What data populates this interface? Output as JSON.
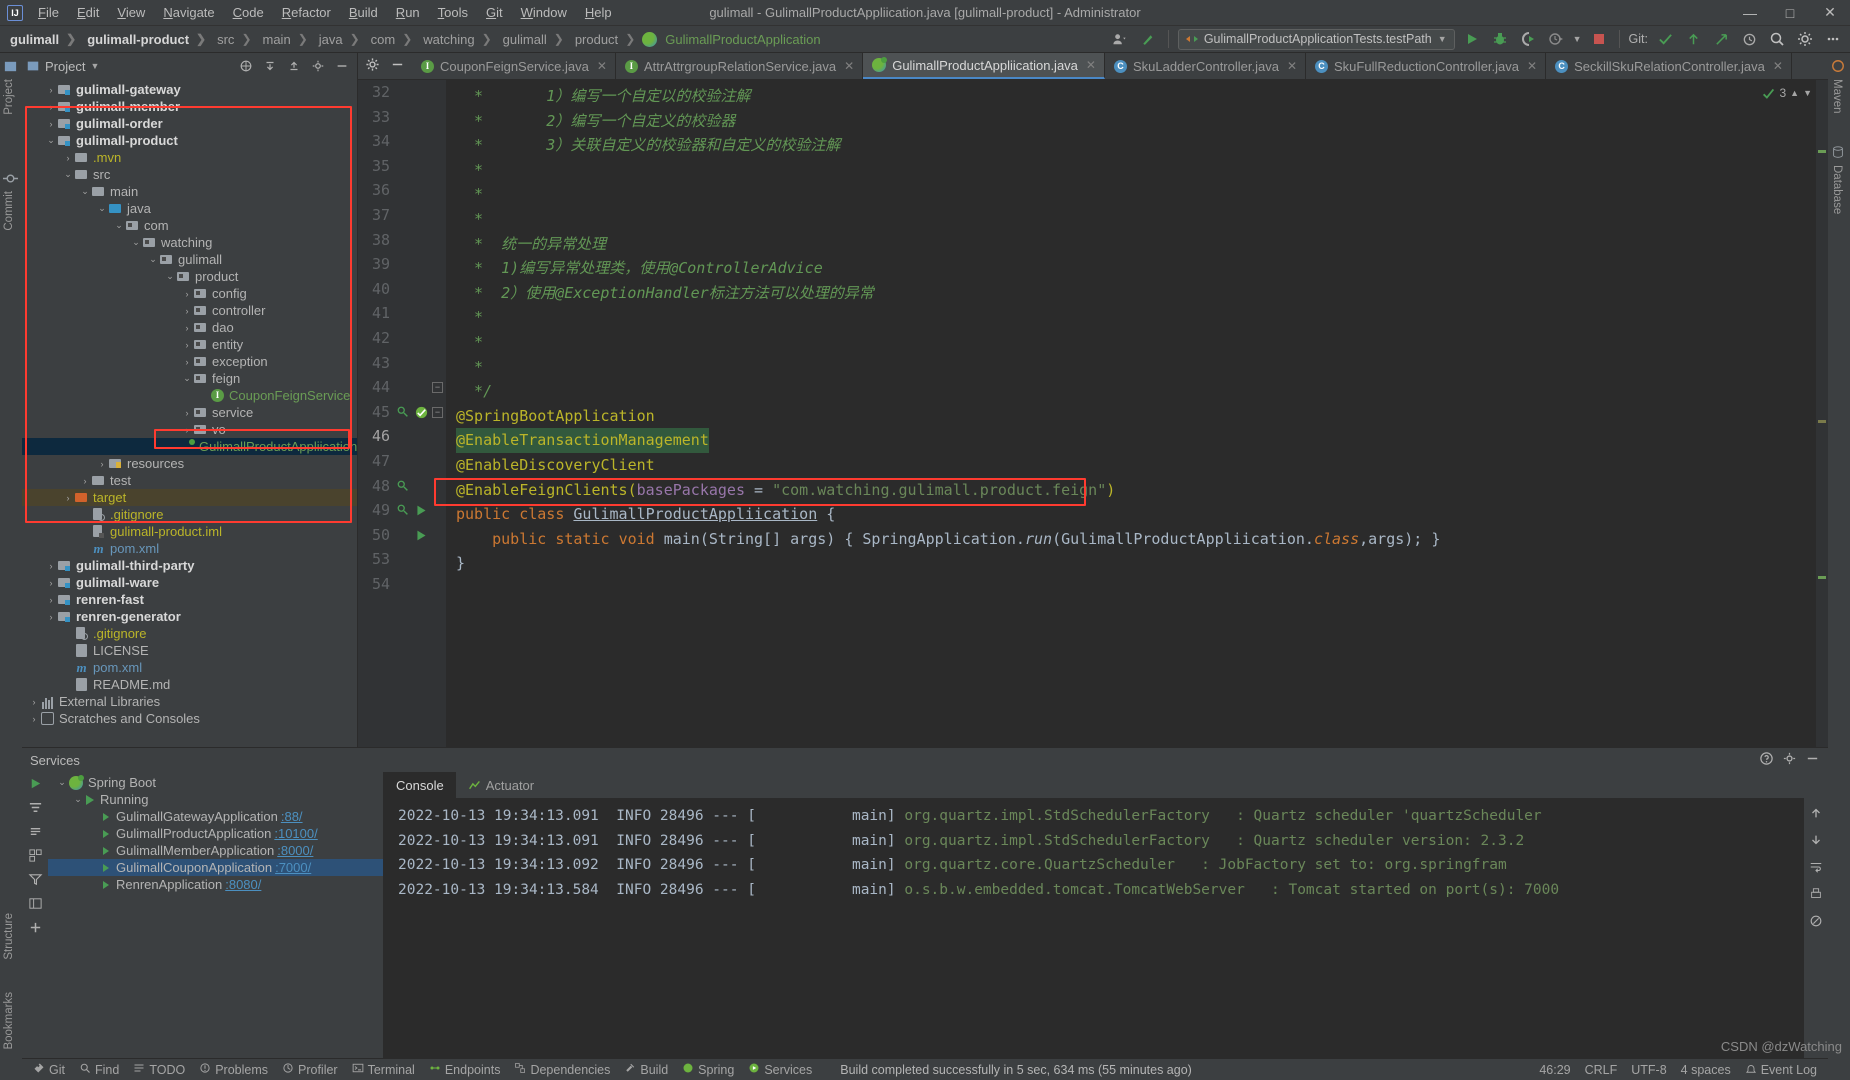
{
  "window": {
    "title": "gulimall - GulimallProductAppliication.java [gulimall-product] - Administrator",
    "minimize": "—",
    "maximize": "□",
    "close": "✕"
  },
  "menu": [
    "File",
    "Edit",
    "View",
    "Navigate",
    "Code",
    "Refactor",
    "Build",
    "Run",
    "Tools",
    "Git",
    "Window",
    "Help"
  ],
  "breadcrumb": [
    {
      "label": "gulimall",
      "style": "bold"
    },
    {
      "label": "gulimall-product",
      "style": "bold"
    },
    {
      "label": "src",
      "style": "plain"
    },
    {
      "label": "main",
      "style": "plain"
    },
    {
      "label": "java",
      "style": "plain"
    },
    {
      "label": "com",
      "style": "plain"
    },
    {
      "label": "watching",
      "style": "plain"
    },
    {
      "label": "gulimall",
      "style": "plain"
    },
    {
      "label": "product",
      "style": "plain"
    },
    {
      "label": "GulimallProductApplication",
      "style": "green"
    }
  ],
  "toolbar": {
    "run_config": "GulimallProductApplicationTests.testPath",
    "git_label": "Git:",
    "icons": [
      "run-icon",
      "debug-icon",
      "run-with-coverage-icon",
      "profile-icon",
      "stop-icon",
      "search-everywhere-icon",
      "settings-icon",
      "more-icon"
    ]
  },
  "project_panel": {
    "title": "Project",
    "tree": [
      {
        "indent": 1,
        "arrow": "›",
        "icon": "module",
        "label": "gulimall-gateway",
        "cls": "bold"
      },
      {
        "indent": 1,
        "arrow": "›",
        "icon": "module",
        "label": "gulimall-member",
        "cls": "bold"
      },
      {
        "indent": 1,
        "arrow": "›",
        "icon": "module",
        "label": "gulimall-order",
        "cls": "bold"
      },
      {
        "indent": 1,
        "arrow": "⌄",
        "icon": "module",
        "label": "gulimall-product",
        "cls": "bold"
      },
      {
        "indent": 2,
        "arrow": "›",
        "icon": "folder",
        "label": ".mvn",
        "cls": "yellow"
      },
      {
        "indent": 2,
        "arrow": "⌄",
        "icon": "folder",
        "label": "src",
        "cls": "gray"
      },
      {
        "indent": 3,
        "arrow": "⌄",
        "icon": "folder",
        "label": "main",
        "cls": "gray"
      },
      {
        "indent": 4,
        "arrow": "⌄",
        "icon": "source",
        "label": "java",
        "cls": "gray"
      },
      {
        "indent": 5,
        "arrow": "⌄",
        "icon": "package",
        "label": "com",
        "cls": "gray"
      },
      {
        "indent": 6,
        "arrow": "⌄",
        "icon": "package",
        "label": "watching",
        "cls": "gray"
      },
      {
        "indent": 7,
        "arrow": "⌄",
        "icon": "package",
        "label": "gulimall",
        "cls": "gray"
      },
      {
        "indent": 8,
        "arrow": "⌄",
        "icon": "package",
        "label": "product",
        "cls": "gray"
      },
      {
        "indent": 9,
        "arrow": "›",
        "icon": "package",
        "label": "config",
        "cls": "gray"
      },
      {
        "indent": 9,
        "arrow": "›",
        "icon": "package",
        "label": "controller",
        "cls": "gray"
      },
      {
        "indent": 9,
        "arrow": "›",
        "icon": "package",
        "label": "dao",
        "cls": "gray"
      },
      {
        "indent": 9,
        "arrow": "›",
        "icon": "package",
        "label": "entity",
        "cls": "gray"
      },
      {
        "indent": 9,
        "arrow": "›",
        "icon": "package",
        "label": "exception",
        "cls": "gray"
      },
      {
        "indent": 9,
        "arrow": "⌄",
        "icon": "package",
        "label": "feign",
        "cls": "gray"
      },
      {
        "indent": 10,
        "arrow": "",
        "icon": "interface",
        "label": "CouponFeignService",
        "cls": "green"
      },
      {
        "indent": 9,
        "arrow": "›",
        "icon": "package",
        "label": "service",
        "cls": "gray"
      },
      {
        "indent": 9,
        "arrow": "›",
        "icon": "package",
        "label": "vo",
        "cls": "gray"
      },
      {
        "indent": 9,
        "arrow": "",
        "icon": "spring",
        "label": "GulimallProductAppliication",
        "cls": "green",
        "state": "selected"
      },
      {
        "indent": 4,
        "arrow": "›",
        "icon": "resources",
        "label": "resources",
        "cls": "gray"
      },
      {
        "indent": 3,
        "arrow": "›",
        "icon": "folder",
        "label": "test",
        "cls": "gray"
      },
      {
        "indent": 2,
        "arrow": "›",
        "icon": "target",
        "label": "target",
        "cls": "yellow",
        "state": "target"
      },
      {
        "indent": 3,
        "arrow": "",
        "icon": "file-ignore",
        "label": ".gitignore",
        "cls": "yellow"
      },
      {
        "indent": 3,
        "arrow": "",
        "icon": "file-iml",
        "label": "gulimall-product.iml",
        "cls": "yellow"
      },
      {
        "indent": 3,
        "arrow": "",
        "icon": "maven",
        "label": "pom.xml",
        "cls": "blue"
      },
      {
        "indent": 1,
        "arrow": "›",
        "icon": "module",
        "label": "gulimall-third-party",
        "cls": "bold"
      },
      {
        "indent": 1,
        "arrow": "›",
        "icon": "module",
        "label": "gulimall-ware",
        "cls": "bold"
      },
      {
        "indent": 1,
        "arrow": "›",
        "icon": "module",
        "label": "renren-fast",
        "cls": "bold"
      },
      {
        "indent": 1,
        "arrow": "›",
        "icon": "module",
        "label": "renren-generator",
        "cls": "bold"
      },
      {
        "indent": 2,
        "arrow": "",
        "icon": "file-ignore",
        "label": ".gitignore",
        "cls": "yellow"
      },
      {
        "indent": 2,
        "arrow": "",
        "icon": "file",
        "label": "LICENSE",
        "cls": "gray"
      },
      {
        "indent": 2,
        "arrow": "",
        "icon": "maven",
        "label": "pom.xml",
        "cls": "blue"
      },
      {
        "indent": 2,
        "arrow": "",
        "icon": "file",
        "label": "README.md",
        "cls": "gray"
      },
      {
        "indent": 0,
        "arrow": "›",
        "icon": "library",
        "label": "External Libraries",
        "cls": "gray"
      },
      {
        "indent": 0,
        "arrow": "›",
        "icon": "scratch",
        "label": "Scratches and Consoles",
        "cls": "gray"
      }
    ]
  },
  "editor": {
    "tabs": [
      {
        "label": "CouponFeignService.java",
        "icon": "interface",
        "active": false
      },
      {
        "label": "AttrAttrgroupRelationService.java",
        "icon": "interface",
        "active": false
      },
      {
        "label": "GulimallProductAppliication.java",
        "icon": "spring",
        "active": true
      },
      {
        "label": "SkuLadderController.java",
        "icon": "class",
        "active": false
      },
      {
        "label": "SkuFullReductionController.java",
        "icon": "class",
        "active": false
      },
      {
        "label": "SeckillSkuRelationController.java",
        "icon": "class",
        "active": false
      }
    ],
    "inspection_count": "3",
    "lines": [
      {
        "n": "32",
        "segs": [
          {
            "t": "  * ",
            "c": "cmt"
          },
          {
            "t": "      1）编写一个自定以的校验注解",
            "c": "cmt italic"
          }
        ]
      },
      {
        "n": "33",
        "segs": [
          {
            "t": "  * ",
            "c": "cmt"
          },
          {
            "t": "      2）编写一个自定义的校验器",
            "c": "cmt italic"
          }
        ]
      },
      {
        "n": "34",
        "segs": [
          {
            "t": "  * ",
            "c": "cmt"
          },
          {
            "t": "      3）关联自定义的校验器和自定义的校验注解",
            "c": "cmt italic"
          }
        ]
      },
      {
        "n": "35",
        "segs": [
          {
            "t": "  *",
            "c": "cmt"
          }
        ]
      },
      {
        "n": "36",
        "segs": [
          {
            "t": "  *",
            "c": "cmt"
          }
        ]
      },
      {
        "n": "37",
        "segs": [
          {
            "t": "  *",
            "c": "cmt"
          }
        ]
      },
      {
        "n": "38",
        "segs": [
          {
            "t": "  * ",
            "c": "cmt"
          },
          {
            "t": " 统一的异常处理",
            "c": "cmt italic"
          }
        ]
      },
      {
        "n": "39",
        "segs": [
          {
            "t": "  * ",
            "c": "cmt"
          },
          {
            "t": " 1)编写异常处理类，使用@ControllerAdvice",
            "c": "cmt italic"
          }
        ]
      },
      {
        "n": "40",
        "segs": [
          {
            "t": "  * ",
            "c": "cmt"
          },
          {
            "t": " 2）使用@ExceptionHandler标注方法可以处理的异常",
            "c": "cmt italic"
          }
        ]
      },
      {
        "n": "41",
        "segs": [
          {
            "t": "  *",
            "c": "cmt"
          }
        ]
      },
      {
        "n": "42",
        "segs": [
          {
            "t": "  *",
            "c": "cmt"
          }
        ]
      },
      {
        "n": "43",
        "segs": [
          {
            "t": "  *",
            "c": "cmt"
          }
        ]
      },
      {
        "n": "44",
        "segs": [
          {
            "t": "  */",
            "c": "cmt"
          }
        ],
        "fold": true
      },
      {
        "n": "45",
        "segs": [
          {
            "t": "@SpringBootApplication",
            "c": "anno"
          }
        ],
        "gutter": "search-run",
        "fold": true
      },
      {
        "n": "46",
        "segs": [
          {
            "t": "@EnableTransactionManagement",
            "c": "anno hl-green"
          }
        ],
        "current": true
      },
      {
        "n": "47",
        "segs": [
          {
            "t": "@EnableDiscoveryClient",
            "c": "anno"
          }
        ]
      },
      {
        "n": "48",
        "segs": [
          {
            "t": "@EnableFeignClients(",
            "c": "anno"
          },
          {
            "t": "basePackages",
            "c": "fld"
          },
          {
            "t": " = ",
            "c": "plain"
          },
          {
            "t": "\"com.watching.gulimall.product.feign\"",
            "c": "str"
          },
          {
            "t": ")",
            "c": "anno"
          }
        ],
        "gutter": "search",
        "highlight_box": true
      },
      {
        "n": "49",
        "segs": [
          {
            "t": "public class ",
            "c": "kw"
          },
          {
            "t": "GulimallProductAppliication",
            "c": "cls underl"
          },
          {
            "t": " {",
            "c": "plain"
          }
        ],
        "gutter": "search-run2"
      },
      {
        "n": "50",
        "segs": [
          {
            "t": "    ",
            "c": "plain"
          },
          {
            "t": "public static ",
            "c": "kw"
          },
          {
            "t": "void ",
            "c": "kw"
          },
          {
            "t": "main",
            "c": "cls"
          },
          {
            "t": "(String[] args) { ",
            "c": "plain"
          },
          {
            "t": "SpringApplication.",
            "c": "plain"
          },
          {
            "t": "run",
            "c": "cls italic"
          },
          {
            "t": "(GulimallProductAppliication.",
            "c": "plain"
          },
          {
            "t": "class",
            "c": "kw italic"
          },
          {
            "t": ",args); }",
            "c": "plain"
          }
        ],
        "gutter": "run"
      },
      {
        "n": "53",
        "segs": [
          {
            "t": "}",
            "c": "plain"
          }
        ]
      },
      {
        "n": "54",
        "segs": [
          {
            "t": "",
            "c": "plain"
          }
        ]
      }
    ]
  },
  "services": {
    "title": "Services",
    "tree": [
      {
        "indent": 0,
        "arrow": "⌄",
        "icon": "spring",
        "label": "Spring Boot",
        "cls": "gray"
      },
      {
        "indent": 1,
        "arrow": "⌄",
        "icon": "run",
        "label": "Running",
        "cls": "gray"
      },
      {
        "indent": 2,
        "arrow": "",
        "icon": "run-item",
        "label": "GulimallGatewayApplication",
        "port": ":88/",
        "cls": "gray"
      },
      {
        "indent": 2,
        "arrow": "",
        "icon": "run-item",
        "label": "GulimallProductApplication",
        "port": ":10100/",
        "cls": "gray"
      },
      {
        "indent": 2,
        "arrow": "",
        "icon": "run-item",
        "label": "GulimallMemberApplication",
        "port": ":8000/",
        "cls": "gray"
      },
      {
        "indent": 2,
        "arrow": "",
        "icon": "run-item",
        "label": "GulimallCouponApplication",
        "port": ":7000/",
        "cls": "gray",
        "state": "selected"
      },
      {
        "indent": 2,
        "arrow": "",
        "icon": "run-item",
        "label": "RenrenApplication",
        "port": ":8080/",
        "cls": "gray"
      }
    ],
    "console_tabs": [
      {
        "label": "Console",
        "icon": "console-icon",
        "active": true
      },
      {
        "label": "Actuator",
        "icon": "actuator-icon",
        "active": false
      }
    ],
    "log": [
      {
        "ts": "2022-10-13 19:34:13.091",
        "level": "INFO",
        "pid": "28496",
        "dash": "---",
        "thread": "[           main]",
        "logger": "org.quartz.impl.StdSchedulerFactory",
        "msg": ": Quartz scheduler 'quartzScheduler"
      },
      {
        "ts": "2022-10-13 19:34:13.091",
        "level": "INFO",
        "pid": "28496",
        "dash": "---",
        "thread": "[           main]",
        "logger": "org.quartz.impl.StdSchedulerFactory",
        "msg": ": Quartz scheduler version: 2.3.2"
      },
      {
        "ts": "2022-10-13 19:34:13.092",
        "level": "INFO",
        "pid": "28496",
        "dash": "---",
        "thread": "[           main]",
        "logger": "org.quartz.core.QuartzScheduler",
        "msg": ": JobFactory set to: org.springfram"
      },
      {
        "ts": "2022-10-13 19:34:13.584",
        "level": "INFO",
        "pid": "28496",
        "dash": "---",
        "thread": "[           main]",
        "logger": "o.s.b.w.embedded.tomcat.TomcatWebServer",
        "msg": ": Tomcat started on port(s): 7000 "
      }
    ]
  },
  "statusbar": {
    "left_items": [
      {
        "label": "Git",
        "icon": "git-icon"
      },
      {
        "label": "Find",
        "icon": "search-icon"
      },
      {
        "label": "TODO",
        "icon": "todo-icon"
      },
      {
        "label": "Problems",
        "icon": "problems-icon"
      },
      {
        "label": "Profiler",
        "icon": "profiler-icon"
      },
      {
        "label": "Terminal",
        "icon": "terminal-icon"
      },
      {
        "label": "Endpoints",
        "icon": "endpoints-icon"
      },
      {
        "label": "Dependencies",
        "icon": "dependencies-icon"
      },
      {
        "label": "Build",
        "icon": "build-icon"
      },
      {
        "label": "Spring",
        "icon": "spring-icon"
      },
      {
        "label": "Services",
        "icon": "services-icon"
      }
    ],
    "message": "Build completed successfully in 5 sec, 634 ms (55 minutes ago)",
    "caret": "46:29",
    "line_sep": "CRLF",
    "encoding": "UTF-8",
    "indent": "4 spaces",
    "event_log": "Event Log",
    "watermark": "CSDN @dzWatching"
  },
  "rails": {
    "left_top": [
      "Project",
      "Commit"
    ],
    "left_bottom": [
      "Structure",
      "Bookmarks"
    ],
    "right_top": [
      "Maven",
      "Database"
    ]
  },
  "colors": {
    "accent_blue": "#4a88c7",
    "annotation_red": "#ff3b30",
    "keyword_orange": "#cc7832",
    "string_green": "#6a8759",
    "comment_green": "#629755",
    "annotation_yellow": "#bbb529",
    "selection_blue": "#0d293e"
  }
}
